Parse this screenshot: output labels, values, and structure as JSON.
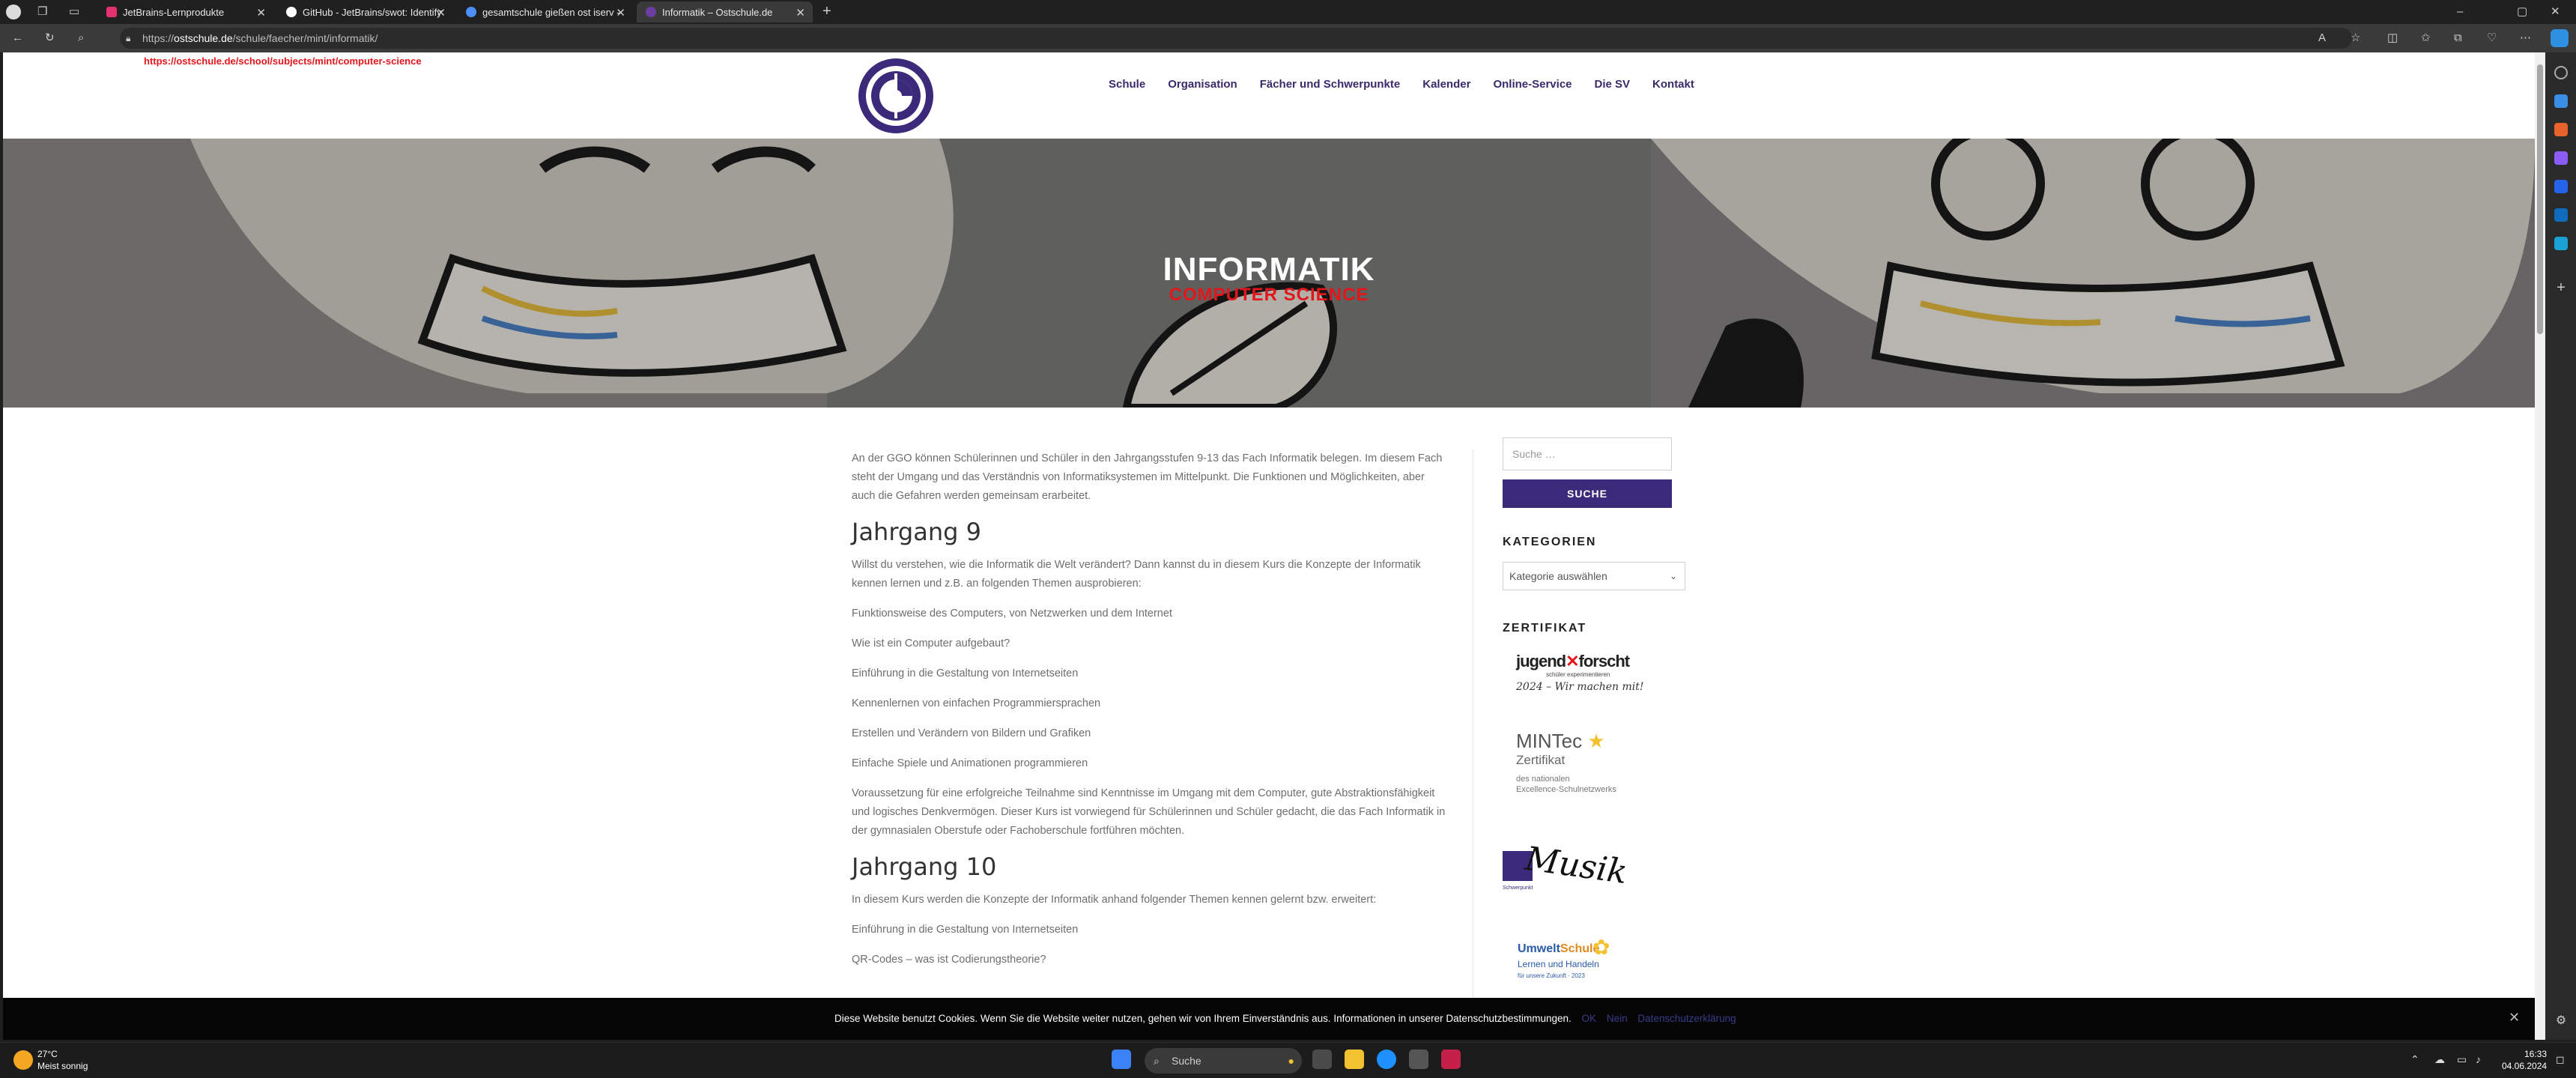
{
  "browser": {
    "tabs": [
      {
        "title": "JetBrains-Lernprodukte",
        "color": "#e53170"
      },
      {
        "title": "GitHub - JetBrains/swot: Identify",
        "color": "#ffffff"
      },
      {
        "title": "gesamtschule gießen ost iserv -",
        "color": "#4f8ef7"
      },
      {
        "title": "Informatik – Ostschule.de",
        "color": "#6b3fa0"
      }
    ],
    "url_host": "ostschule.de",
    "url_path": "/schule/faecher/mint/informatik/",
    "url_scheme": "https://"
  },
  "page": {
    "redirect_url": "https://ostschule.de/school/subjects/mint/computer-science",
    "nav": [
      "Schule",
      "Organisation",
      "Fächer und Schwerpunkte",
      "Kalender",
      "Online-Service",
      "Die SV",
      "Kontakt"
    ],
    "hero": {
      "title": "INFORMATIK",
      "subtitle": "COMPUTER SCIENCE"
    },
    "intro": "An der GGO können Schülerinnen und Schüler in den Jahrgangsstufen 9-13 das Fach Informatik belegen. Im diesem Fach steht der Umgang und das Verständnis von Informatiksystemen im Mittelpunkt. Die Funktionen und Möglichkeiten, aber auch die Gefahren werden gemeinsam erarbeitet.",
    "jg9": {
      "heading": "Jahrgang 9",
      "lead": "Willst du verstehen, wie die Informatik die Welt verändert? Dann kannst du in diesem Kurs die Konzepte der Informatik kennen lernen und z.B. an folgenden Themen ausprobieren:",
      "topics": [
        "Funktionsweise des Computers, von Netzwerken und dem Internet",
        "Wie ist ein Computer aufgebaut?",
        "Einführung in die Gestaltung von Internetseiten",
        "Kennenlernen von einfachen Programmiersprachen",
        "Erstellen und Verändern von Bildern und Grafiken",
        "Einfache Spiele und Animationen programmieren"
      ],
      "requirements": "Voraussetzung für eine erfolgreiche Teilnahme sind Kenntnisse im Umgang mit dem Computer, gute Abstraktionsfähigkeit und logisches Denkvermögen. Dieser Kurs ist vorwiegend für Schülerinnen und Schüler gedacht, die das Fach Informatik in der gymnasialen Oberstufe oder Fachoberschule fortführen möchten."
    },
    "jg10": {
      "heading": "Jahrgang 10",
      "lead": "In diesem Kurs werden die Konzepte der Informatik anhand folgender Themen kennen gelernt bzw. erweitert:",
      "topics": [
        "Einführung in die Gestaltung von Internetseiten",
        "QR-Codes – was ist Codierungstheorie?"
      ]
    },
    "sidebar": {
      "search_placeholder": "Suche …",
      "search_button": "SUCHE",
      "categories_title": "KATEGORIEN",
      "categories_select": "Kategorie auswählen",
      "cert_title": "ZERTIFIKAT",
      "jufo_line1": "jugend",
      "jufo_line2": "forscht",
      "jufo_sub": "schüler experimentieren",
      "jufo_year": "2024 – Wir machen mit!",
      "mintec_name": "MINTec",
      "mintec_cert": "Zertifikat",
      "mintec_desc1": "des nationalen",
      "mintec_desc2": "Excellence-Schulnetzwerks",
      "musik_label": "Musik",
      "musik_small": "Schwerpunkt",
      "umwelt_1": "Umwelt",
      "umwelt_2": "Schule",
      "umwelt_3": "Lernen und Handeln",
      "umwelt_4": "für unsere Zukunft · 2023"
    },
    "cookie": {
      "text": "Diese Website benutzt Cookies. Wenn Sie die Website weiter nutzen, gehen wir von Ihrem Einverständnis aus. Informationen in unserer Datenschutzbestimmungen.",
      "ok": "OK",
      "no": "Nein",
      "privacy": "Datenschutzerklärung"
    }
  },
  "taskbar": {
    "weather_temp": "27°C",
    "weather_text": "Meist sonnig",
    "search": "Suche",
    "time": "16:33",
    "date": "04.06.2024"
  },
  "colors": {
    "brand": "#3b2a7a",
    "accent": "#e4161c"
  }
}
